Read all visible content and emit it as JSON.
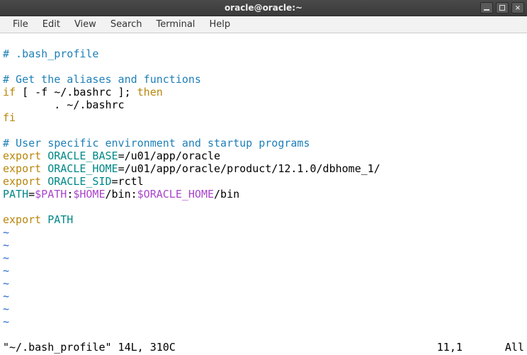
{
  "window": {
    "title": "oracle@oracle:~"
  },
  "menu": {
    "file": "File",
    "edit": "Edit",
    "view": "View",
    "search": "Search",
    "terminal": "Terminal",
    "help": "Help"
  },
  "lines": {
    "l1_comment": "# .bash_profile",
    "l3_comment": "# Get the aliases and functions",
    "l4_if": "if",
    "l4_cond": " [ -f ~/.bashrc ]; ",
    "l4_then": "then",
    "l5_body": "        . ~/.bashrc",
    "l6_fi": "fi",
    "l8_comment": "# User specific environment and startup programs",
    "l9_export": "export",
    "l9_var": " ORACLE_BASE",
    "l9_rest": "=/u01/app/oracle",
    "l10_export": "export",
    "l10_var": " ORACLE_HOME",
    "l10_rest": "=/u01/app/oracle/product/12.1.0/dbhome_1/",
    "l11_export": "export",
    "l11_var": " ORACLE_SID",
    "l11_rest": "=rctl",
    "l12_path": "PATH",
    "l12_eq": "=",
    "l12_v1": "$PATH",
    "l12_sep1": ":",
    "l12_v2": "$HOME",
    "l12_mid": "/bin:",
    "l12_v3": "$ORACLE_HOME",
    "l12_end": "/bin",
    "l14_export": "export",
    "l14_var": " PATH",
    "tilde": "~",
    "status_file": "\"~/.bash_profile\" 14L, 310C",
    "status_pos": "11,1",
    "status_pct": "All"
  }
}
